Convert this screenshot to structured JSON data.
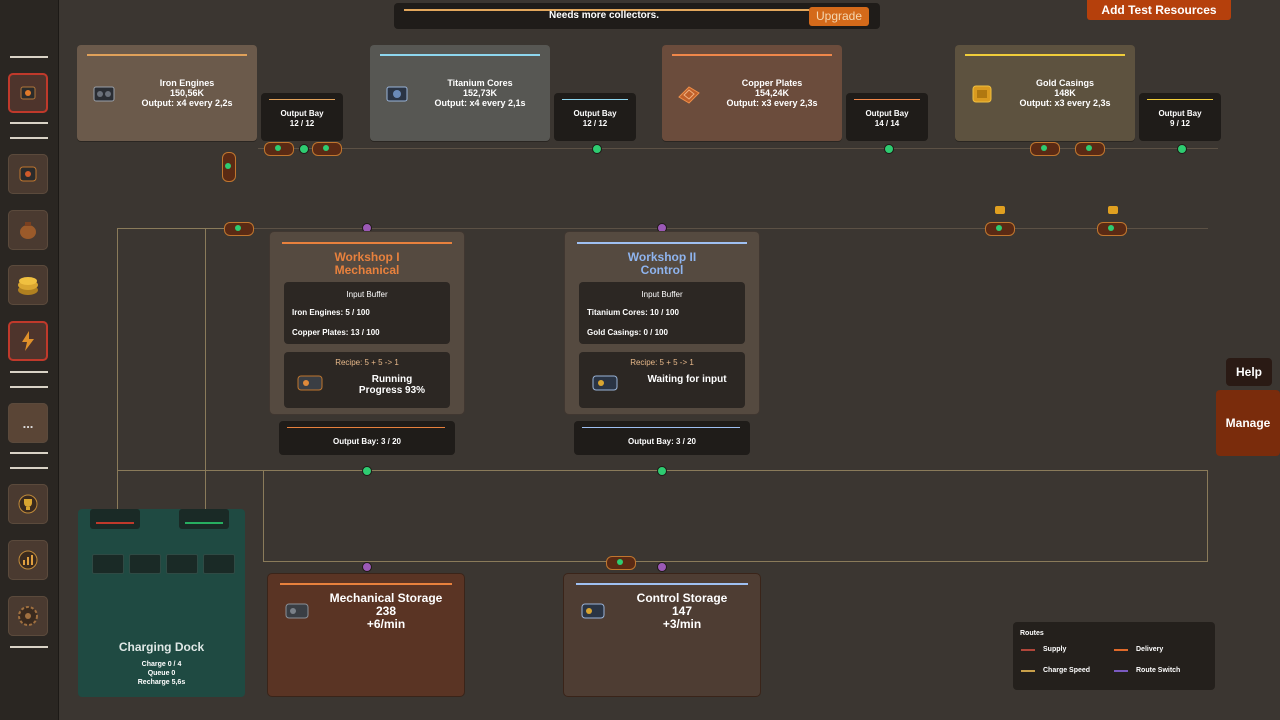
{
  "topbar": {
    "message": "Needs more collectors.",
    "upgrade_label": "Upgrade"
  },
  "add_resources_label": "Add Test Resources",
  "generators": [
    {
      "name": "Iron Engines",
      "amount": "150,56K",
      "output": "Output: x4 every 2,2s",
      "bay_label": "Output Bay",
      "bay_value": "12 / 12",
      "accent": "#e0a15a",
      "bg": "#6b5a4b",
      "icon": "iron-engine-icon"
    },
    {
      "name": "Titanium Cores",
      "amount": "152,73K",
      "output": "Output: x4 every 2,1s",
      "bay_label": "Output Bay",
      "bay_value": "12 / 12",
      "accent": "#8ed7ef",
      "bg": "#575753",
      "icon": "titanium-core-icon"
    },
    {
      "name": "Copper Plates",
      "amount": "154,24K",
      "output": "Output: x3 every 2,3s",
      "bay_label": "Output Bay",
      "bay_value": "14 / 14",
      "accent": "#f0874a",
      "bg": "#6b4c3c",
      "icon": "copper-plate-icon"
    },
    {
      "name": "Gold Casings",
      "amount": "148K",
      "output": "Output: x3 every 2,3s",
      "bay_label": "Output Bay",
      "bay_value": "9 / 12",
      "accent": "#f0cd3a",
      "bg": "#5d523f",
      "icon": "gold-casing-icon"
    }
  ],
  "workshops": [
    {
      "title_line1": "Workshop I",
      "title_line2": "Mechanical",
      "title_color": "#e8813d",
      "accent": "#e8813d",
      "buffer_label": "Input Buffer",
      "inputs": [
        "Iron Engines: 5 / 100",
        "Copper Plates: 13 / 100"
      ],
      "recipe": "Recipe: 5 + 5 -> 1",
      "status_line1": "Running",
      "status_line2": "Progress 93%",
      "recipe_color": "#e8b98a",
      "output_bay": "Output Bay: 3 / 20"
    },
    {
      "title_line1": "Workshop II",
      "title_line2": "Control",
      "title_color": "#8fb4ee",
      "accent": "#9fc0f2",
      "buffer_label": "Input Buffer",
      "inputs": [
        "Titanium Cores: 10 / 100",
        "Gold Casings: 0 / 100"
      ],
      "recipe": "Recipe: 5 + 5 -> 1",
      "status_line1": "Waiting for input",
      "status_line2": "",
      "recipe_color": "#e8b98a",
      "output_bay": "Output Bay: 3 / 20"
    }
  ],
  "storages": [
    {
      "name": "Mechanical Storage",
      "amount": "238",
      "rate": "+6/min",
      "accent": "#e8813d"
    },
    {
      "name": "Control Storage",
      "amount": "147",
      "rate": "+3/min",
      "accent": "#9fc0f2"
    }
  ],
  "dock": {
    "title": "Charging Dock",
    "charge": "Charge 0 / 4",
    "queue": "Queue 0",
    "recharge": "Recharge 5,6s"
  },
  "help_label": "Help",
  "manage_label": "Manage",
  "legend": {
    "title": "Routes",
    "items": [
      {
        "label": "Supply",
        "color": "#b0463a"
      },
      {
        "label": "Delivery",
        "color": "#e06a2a"
      },
      {
        "label": "Charge Speed",
        "color": "#c9a04a"
      },
      {
        "label": "Route Switch",
        "color": "#7a5ac0"
      }
    ]
  },
  "sidebar": {
    "ellipsis_label": "..."
  }
}
